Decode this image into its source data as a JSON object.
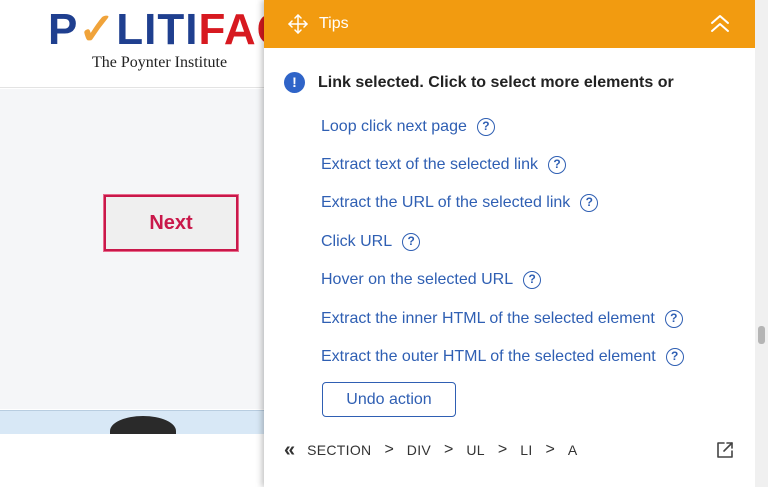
{
  "site": {
    "logo_part1": "P",
    "logo_check": "✓",
    "logo_part2": "LITI",
    "logo_part3": "FAC",
    "tagline": "The Poynter Institute",
    "next_label": "Next"
  },
  "tips": {
    "title": "Tips",
    "info_glyph": "!",
    "message": "Link selected. Click to select more elements or",
    "options": [
      {
        "label": "Loop click next page"
      },
      {
        "label": "Extract text of the selected link"
      },
      {
        "label": "Extract the URL of the selected link"
      },
      {
        "label": "Click URL"
      },
      {
        "label": "Hover on the selected URL"
      },
      {
        "label": "Extract the inner HTML of the selected element"
      },
      {
        "label": "Extract the outer HTML of the selected element"
      }
    ],
    "help_glyph": "?",
    "undo_label": "Undo action",
    "breadcrumb": {
      "back_glyph": "«",
      "separator": ">",
      "items": [
        "SECTION",
        "DIV",
        "UL",
        "LI",
        "A"
      ]
    }
  },
  "colors": {
    "header": "#f29b10",
    "link": "#2f5fb3",
    "info": "#2f64c8",
    "next_border": "#c9184a"
  }
}
